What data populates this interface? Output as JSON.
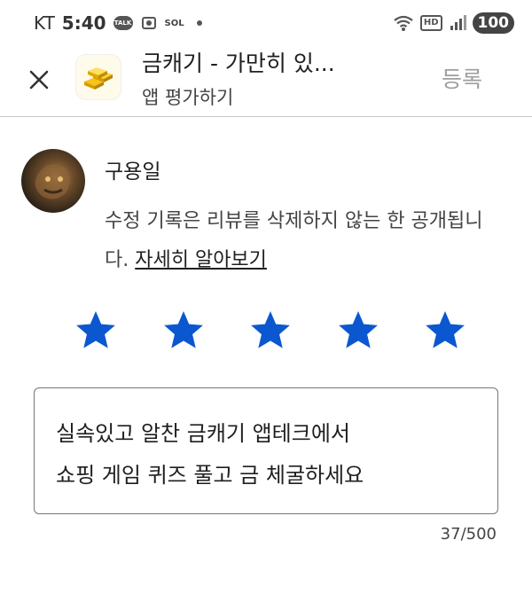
{
  "status_bar": {
    "carrier": "KT",
    "time": "5:40",
    "talk_label": "TALK",
    "sol_label": "SOL",
    "battery": "100",
    "hd_label": "HD"
  },
  "header": {
    "app_title": "금캐기 - 가만히 있...",
    "subtitle": "앱 평가하기",
    "register_label": "등록"
  },
  "review": {
    "user_name": "구용일",
    "notice_text": "수정 기록은 리뷰를 삭제하지 않는 한 공개됩니다. ",
    "learn_more": "자세히 알아보기",
    "rating": 5,
    "max_rating": 5,
    "text_line1": "실속있고 알찬 금캐기 앱테크에서",
    "text_line2": "쇼핑 게임 퀴즈 풀고 금 체굴하세요",
    "char_count": "37/500"
  },
  "colors": {
    "star": "#0b57d0",
    "register_disabled": "#9e9e9e",
    "divider": "#c7c7c7"
  },
  "icons": {
    "close": "close-icon",
    "app": "gold-bars-icon",
    "star": "star-icon"
  }
}
